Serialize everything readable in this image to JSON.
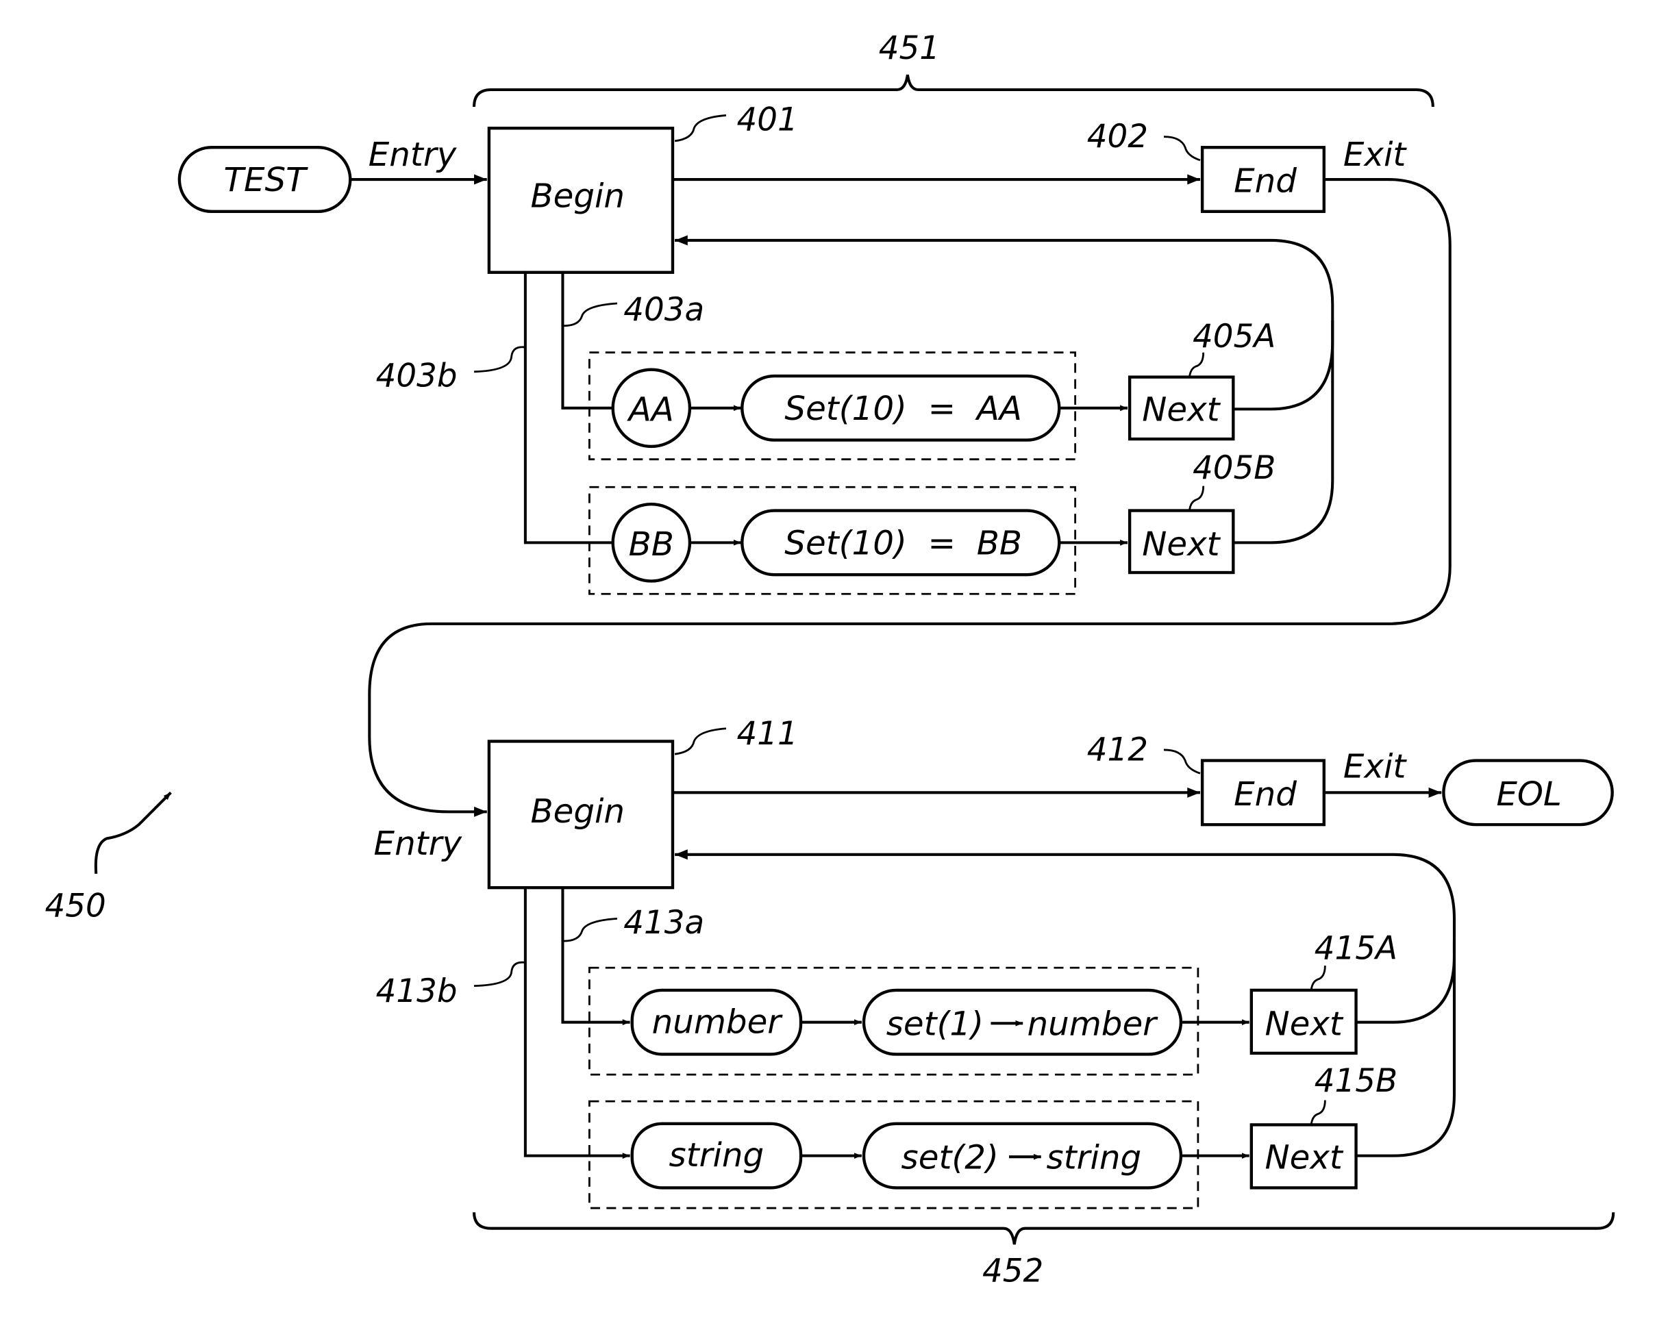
{
  "figure": {
    "figure_ref": "450",
    "bracket_top_ref": "451",
    "bracket_bottom_ref": "452"
  },
  "top_section": {
    "start_node": "TEST",
    "entry_label": "Entry",
    "begin": {
      "text": "Begin",
      "ref": "401"
    },
    "end": {
      "text": "End",
      "ref": "402"
    },
    "exit_label": "Exit",
    "branch_a_ref": "403a",
    "branch_b_ref": "403b",
    "rows": [
      {
        "match": "AA",
        "action": "Set(10)  =  AA",
        "next": "Next",
        "next_ref": "405A"
      },
      {
        "match": "BB",
        "action": "Set(10)  =  BB",
        "next": "Next",
        "next_ref": "405B"
      }
    ]
  },
  "bottom_section": {
    "entry_label": "Entry",
    "begin": {
      "text": "Begin",
      "ref": "411"
    },
    "end": {
      "text": "End",
      "ref": "412"
    },
    "exit_label": "Exit",
    "end_node": "EOL",
    "branch_a_ref": "413a",
    "branch_b_ref": "413b",
    "rows": [
      {
        "match": "number",
        "action_pre": "set(1)",
        "action_post": "number",
        "next": "Next",
        "next_ref": "415A"
      },
      {
        "match": "string",
        "action_pre": "set(2)",
        "action_post": "string",
        "next": "Next",
        "next_ref": "415B"
      }
    ]
  }
}
